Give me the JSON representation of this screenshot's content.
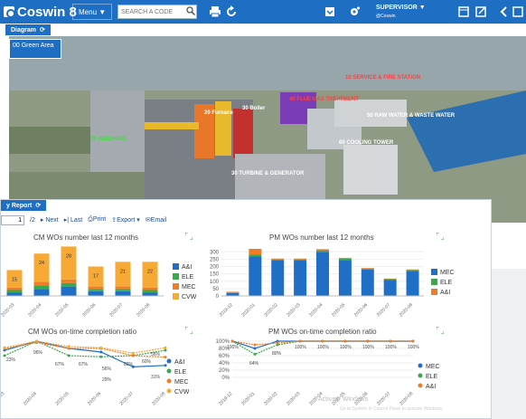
{
  "app": {
    "logo": "Coswin 8"
  },
  "topbar": {
    "menu_label": "Menu ▼",
    "search_placeholder": "SEARCH A CODE",
    "user_role": "SUPERVISOR",
    "user_org": "@Coswin",
    "user_caret": "▼"
  },
  "diagram": {
    "tab_label": "Diagram",
    "area_button": "00 Green Area",
    "labels": [
      {
        "text": "10 SERVICE & FIRE STATION",
        "color": "#ff4040"
      },
      {
        "text": "20 Furnace",
        "color": "#ffffff"
      },
      {
        "text": "30 Boiler",
        "color": "#ffffff"
      },
      {
        "text": "40 FLUE GAS TREATMENT",
        "color": "#ff4040"
      },
      {
        "text": "50 RAW WATER & WASTE WATER",
        "color": "#ffffff"
      },
      {
        "text": "60 COOLING TOWER",
        "color": "#ffffff"
      },
      {
        "text": "70 WEIGHING",
        "color": "#3ce03c"
      },
      {
        "text": "30 TURBINE & GENERATOR",
        "color": "#ffffff"
      }
    ]
  },
  "report": {
    "tab_label": "y Report",
    "page_current": "1",
    "page_total": "/2",
    "next": "Next",
    "last": "Last",
    "print": "Print",
    "export": "Export",
    "email": "Email"
  },
  "colors": {
    "brand": "#1e6fc4",
    "series_1": "#1f6fc7",
    "series_2": "#3aa84c",
    "series_3": "#f07c26",
    "series_4": "#f7a935"
  },
  "chart_data": [
    {
      "type": "bar",
      "title": "CM WOs number last 12 months",
      "categories": [
        "2020-03",
        "2020-04",
        "2020-05",
        "2020-06",
        "2020-07",
        "2020-08"
      ],
      "series": [
        {
          "name": "A&I",
          "values": [
            3,
            6,
            8,
            4,
            4,
            3
          ]
        },
        {
          "name": "ELE",
          "values": [
            2,
            3,
            3,
            2,
            2,
            2
          ]
        },
        {
          "name": "MEC",
          "values": [
            2,
            3,
            3,
            2,
            2,
            2
          ]
        },
        {
          "name": "CVW",
          "values": [
            15,
            24,
            28,
            17,
            21,
            22
          ]
        }
      ],
      "data_labels": [
        "15",
        "24",
        "28",
        "17",
        "21",
        "22"
      ],
      "ylim": [
        0,
        40
      ]
    },
    {
      "type": "bar",
      "title": "PM WOs number last 12 months",
      "categories": [
        "2019-12",
        "2020-01",
        "2020-02",
        "2020-03",
        "2020-04",
        "2020-05",
        "2020-06",
        "2020-07",
        "2020-08"
      ],
      "series": [
        {
          "name": "MEC",
          "values": [
            20,
            270,
            240,
            240,
            300,
            245,
            180,
            110,
            170
          ]
        },
        {
          "name": "ELE",
          "values": [
            4,
            10,
            8,
            8,
            10,
            8,
            6,
            4,
            6
          ]
        },
        {
          "name": "A&I",
          "values": [
            4,
            40,
            6,
            6,
            8,
            6,
            4,
            4,
            4
          ]
        }
      ],
      "yticks": [
        "0",
        "50",
        "100",
        "150",
        "200",
        "250",
        "300"
      ],
      "ylim": [
        0,
        320
      ]
    },
    {
      "type": "line",
      "title": "CM WOs on-time completion ratio",
      "categories": [
        "2020-03",
        "2020-04",
        "2020-05",
        "2020-06",
        "2020-07",
        "2020-08"
      ],
      "series": [
        {
          "name": "A&I",
          "values": [
            75,
            100,
            80,
            70,
            29,
            33
          ]
        },
        {
          "name": "ELE",
          "values": [
            60,
            100,
            60,
            57,
            60,
            75
          ]
        },
        {
          "name": "MEC",
          "values": [
            80,
            96,
            80,
            80,
            60,
            56
          ]
        },
        {
          "name": "CVW",
          "values": [
            82,
            100,
            85,
            82,
            67,
            82
          ]
        }
      ],
      "data_labels": [
        "23%",
        "96%",
        "67%",
        "67%",
        "29%",
        "31%",
        "82%",
        "60%",
        "56%",
        "56%"
      ],
      "ylim": [
        0,
        100
      ]
    },
    {
      "type": "line",
      "title": "PM WOs on-time completion ratio",
      "categories": [
        "2019-12",
        "2020-01",
        "2020-02",
        "2020-03",
        "2020-04",
        "2020-05",
        "2020-06",
        "2020-07",
        "2020-08"
      ],
      "series": [
        {
          "name": "MEC",
          "values": [
            100,
            80,
            100,
            100,
            100,
            100,
            100,
            100,
            100
          ]
        },
        {
          "name": "ELE",
          "values": [
            100,
            64,
            90,
            100,
            100,
            100,
            100,
            100,
            100
          ]
        },
        {
          "name": "A&I",
          "values": [
            100,
            90,
            95,
            100,
            100,
            100,
            100,
            100,
            100
          ]
        }
      ],
      "yticks": [
        "0%",
        "20%",
        "40%",
        "60%",
        "80%",
        "100%"
      ],
      "data_labels": [
        "100%",
        "64%",
        "80%",
        "100%",
        "100%",
        "100%",
        "100%",
        "100%",
        "100%"
      ],
      "ylim": [
        0,
        100
      ]
    }
  ],
  "watermark": {
    "line1": "Activate Windows",
    "line2": "Go to System in Control Panel to activate Windows."
  }
}
